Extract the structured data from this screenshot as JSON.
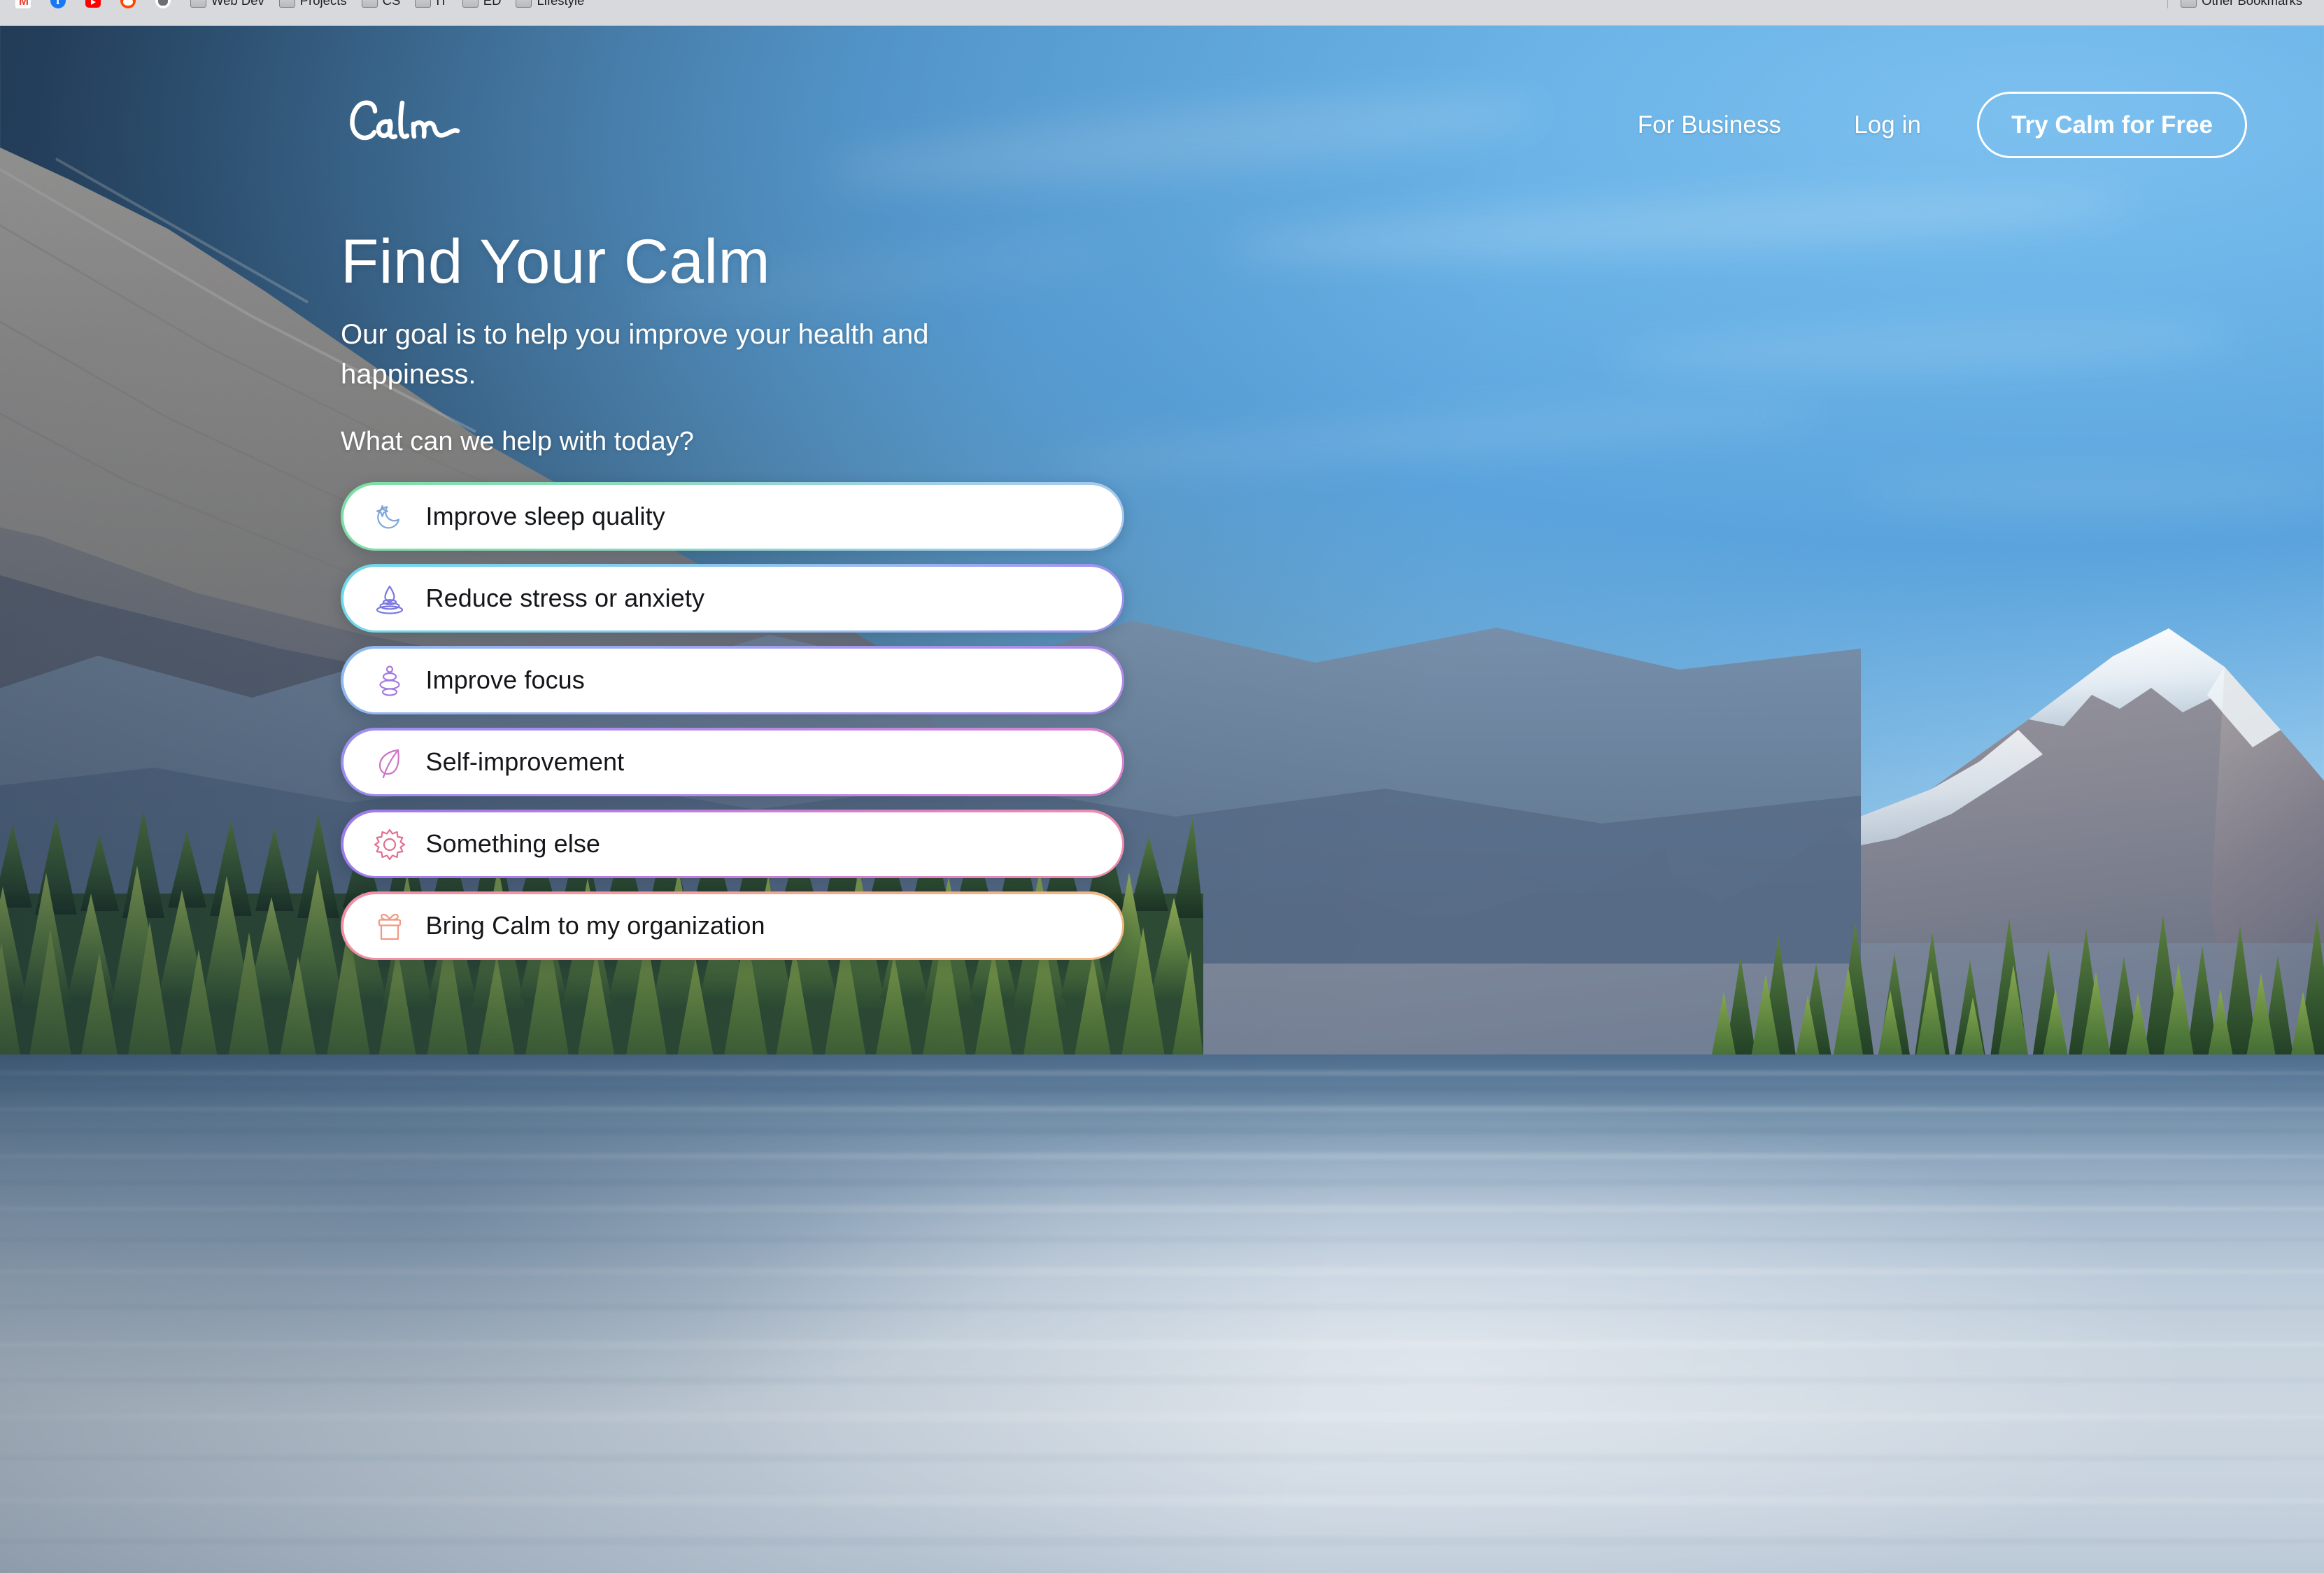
{
  "browser": {
    "bookmarks": [
      {
        "label": "",
        "icon": "gmail-favicon"
      },
      {
        "label": "",
        "icon": "facebook-favicon"
      },
      {
        "label": "",
        "icon": "youtube-favicon"
      },
      {
        "label": "",
        "icon": "reddit-favicon"
      },
      {
        "label": "",
        "icon": "github-favicon"
      },
      {
        "label": "Web Dev",
        "icon": "folder-icon"
      },
      {
        "label": "Projects",
        "icon": "folder-icon"
      },
      {
        "label": "CS",
        "icon": "folder-icon"
      },
      {
        "label": "IT",
        "icon": "folder-icon"
      },
      {
        "label": "ED",
        "icon": "folder-icon"
      },
      {
        "label": "Lifestyle",
        "icon": "folder-icon"
      }
    ],
    "other_bookmarks": {
      "label": "Other Bookmarks",
      "icon": "folder-icon"
    }
  },
  "header": {
    "logo_text": "Calm",
    "nav": [
      {
        "label": "For Business",
        "name": "nav-for-business"
      },
      {
        "label": "Log in",
        "name": "nav-log-in"
      }
    ],
    "cta": {
      "label": "Try Calm for Free"
    }
  },
  "hero": {
    "title": "Find Your Calm",
    "subtitle": "Our goal is to help you improve your health and happiness.",
    "prompt": "What can we help with today?"
  },
  "options": [
    {
      "label": "Improve sleep quality",
      "icon": "moon-sparkle-icon",
      "icon_color": "#7fa8d8",
      "gradient_from": "#7ddfa4",
      "gradient_to": "#a8c9ee",
      "name": "option-improve-sleep-quality"
    },
    {
      "label": "Reduce stress or anxiety",
      "icon": "water-drop-ripple-icon",
      "icon_color": "#7b77e0",
      "gradient_from": "#6fd8e8",
      "gradient_to": "#9f8ef0",
      "name": "option-reduce-stress-or-anxiety"
    },
    {
      "label": "Improve focus",
      "icon": "stacked-stones-icon",
      "icon_color": "#a57ae0",
      "gradient_from": "#8fb9ef",
      "gradient_to": "#b189ea",
      "name": "option-improve-focus"
    },
    {
      "label": "Self-improvement",
      "icon": "leaf-icon",
      "icon_color": "#d072c4",
      "gradient_from": "#9a8fef",
      "gradient_to": "#dd83cf",
      "name": "option-self-improvement"
    },
    {
      "label": "Something else",
      "icon": "sun-burst-icon",
      "icon_color": "#e0708f",
      "gradient_from": "#9e7bec",
      "gradient_to": "#ef8fae",
      "name": "option-something-else"
    },
    {
      "label": "Bring Calm to my organization",
      "icon": "gift-box-icon",
      "icon_color": "#ef9a84",
      "gradient_from": "#ef8fa6",
      "gradient_to": "#eeba84",
      "name": "option-bring-calm-to-my-organization"
    }
  ],
  "scene": {
    "description": "Mountain lake with snow-capped peaks, conifer forest island and still reflective water",
    "sky_color": "#5f9fd0",
    "water_color": "#b9c8d8"
  }
}
